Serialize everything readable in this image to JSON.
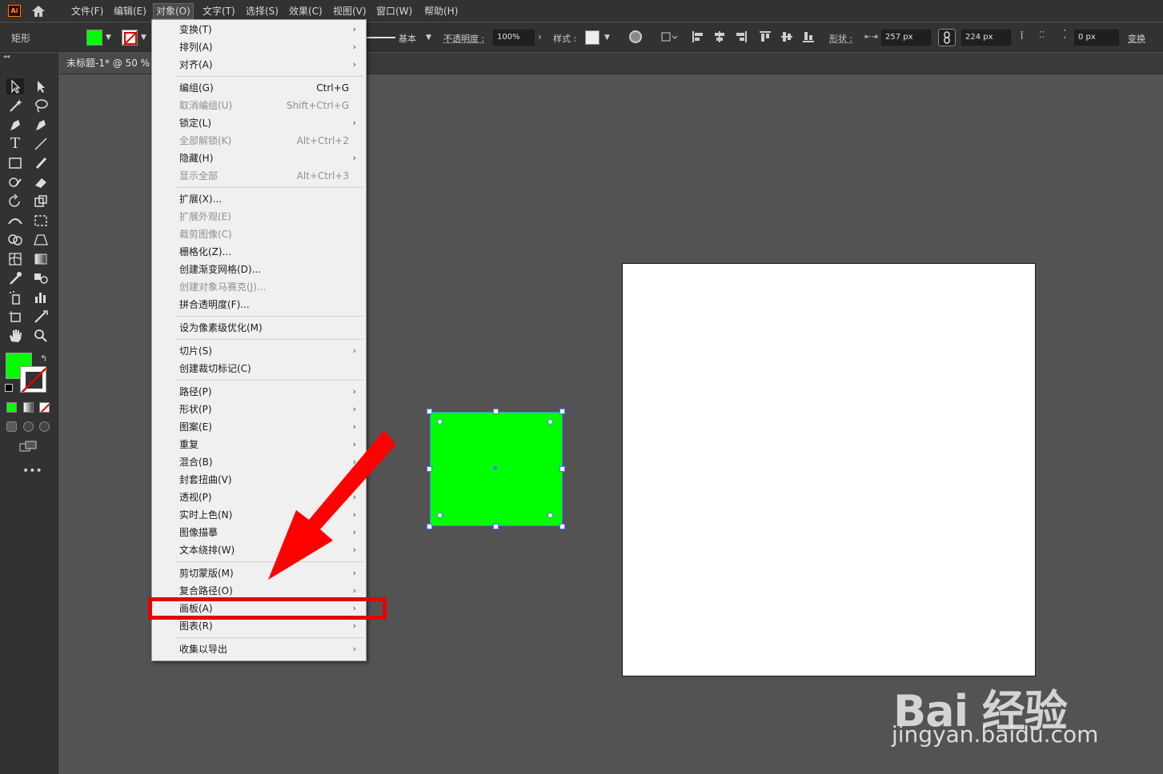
{
  "app": {
    "logo_text": "Ai",
    "menus": [
      "文件(F)",
      "编辑(E)",
      "对象(O)",
      "文字(T)",
      "选择(S)",
      "效果(C)",
      "视图(V)",
      "窗口(W)",
      "帮助(H)"
    ],
    "active_menu": "对象(O)"
  },
  "controlbar": {
    "mode": "矩形",
    "stroke_weight_label": "基本",
    "opacity_label": "不透明度 :",
    "opacity_value": "100%",
    "style_label": "样式 :",
    "shape_label": "形状 :",
    "width_value": "257 px",
    "height_value": "224 px",
    "corner_value": "0 px",
    "transform_label": "变换"
  },
  "document": {
    "tab_title": "未标题-1* @ 50 %"
  },
  "colors": {
    "fill": "#00ff00",
    "artboard": "#ffffff",
    "highlight": "#e60000"
  },
  "menu_items": [
    {
      "label": "变换(T)",
      "shortcut": "",
      "submenu": true,
      "disabled": false
    },
    {
      "label": "排列(A)",
      "shortcut": "",
      "submenu": true,
      "disabled": false
    },
    {
      "label": "对齐(A)",
      "shortcut": "",
      "submenu": true,
      "disabled": false
    },
    {
      "label": "编组(G)",
      "shortcut": "Ctrl+G",
      "submenu": false,
      "disabled": false
    },
    {
      "label": "取消编组(U)",
      "shortcut": "Shift+Ctrl+G",
      "submenu": false,
      "disabled": true
    },
    {
      "label": "锁定(L)",
      "shortcut": "",
      "submenu": true,
      "disabled": false
    },
    {
      "label": "全部解锁(K)",
      "shortcut": "Alt+Ctrl+2",
      "submenu": false,
      "disabled": true
    },
    {
      "label": "隐藏(H)",
      "shortcut": "",
      "submenu": true,
      "disabled": false
    },
    {
      "label": "显示全部",
      "shortcut": "Alt+Ctrl+3",
      "submenu": false,
      "disabled": true
    },
    {
      "label": "扩展(X)...",
      "shortcut": "",
      "submenu": false,
      "disabled": false
    },
    {
      "label": "扩展外观(E)",
      "shortcut": "",
      "submenu": false,
      "disabled": true
    },
    {
      "label": "裁剪图像(C)",
      "shortcut": "",
      "submenu": false,
      "disabled": true
    },
    {
      "label": "栅格化(Z)...",
      "shortcut": "",
      "submenu": false,
      "disabled": false
    },
    {
      "label": "创建渐变网格(D)...",
      "shortcut": "",
      "submenu": false,
      "disabled": false
    },
    {
      "label": "创建对象马赛克(J)...",
      "shortcut": "",
      "submenu": false,
      "disabled": true
    },
    {
      "label": "拼合透明度(F)...",
      "shortcut": "",
      "submenu": false,
      "disabled": false
    },
    {
      "label": "设为像素级优化(M)",
      "shortcut": "",
      "submenu": false,
      "disabled": false
    },
    {
      "label": "切片(S)",
      "shortcut": "",
      "submenu": true,
      "disabled": false
    },
    {
      "label": "创建裁切标记(C)",
      "shortcut": "",
      "submenu": false,
      "disabled": false
    },
    {
      "label": "路径(P)",
      "shortcut": "",
      "submenu": true,
      "disabled": false
    },
    {
      "label": "形状(P)",
      "shortcut": "",
      "submenu": true,
      "disabled": false
    },
    {
      "label": "图案(E)",
      "shortcut": "",
      "submenu": true,
      "disabled": false
    },
    {
      "label": "重复",
      "shortcut": "",
      "submenu": true,
      "disabled": false
    },
    {
      "label": "混合(B)",
      "shortcut": "",
      "submenu": true,
      "disabled": false
    },
    {
      "label": "封套扭曲(V)",
      "shortcut": "",
      "submenu": true,
      "disabled": false
    },
    {
      "label": "透视(P)",
      "shortcut": "",
      "submenu": true,
      "disabled": false
    },
    {
      "label": "实时上色(N)",
      "shortcut": "",
      "submenu": true,
      "disabled": false
    },
    {
      "label": "图像描摹",
      "shortcut": "",
      "submenu": true,
      "disabled": false
    },
    {
      "label": "文本绕排(W)",
      "shortcut": "",
      "submenu": true,
      "disabled": false
    },
    {
      "label": "剪切蒙版(M)",
      "shortcut": "",
      "submenu": true,
      "disabled": false
    },
    {
      "label": "复合路径(O)",
      "shortcut": "",
      "submenu": true,
      "disabled": false
    },
    {
      "label": "画板(A)",
      "shortcut": "",
      "submenu": true,
      "disabled": false
    },
    {
      "label": "图表(R)",
      "shortcut": "",
      "submenu": true,
      "disabled": false
    },
    {
      "label": "收集以导出",
      "shortcut": "",
      "submenu": true,
      "disabled": false
    }
  ],
  "highlighted_item": "画板(A)",
  "watermark": {
    "brand": "Bai 经验",
    "url": "jingyan.baidu.com"
  }
}
